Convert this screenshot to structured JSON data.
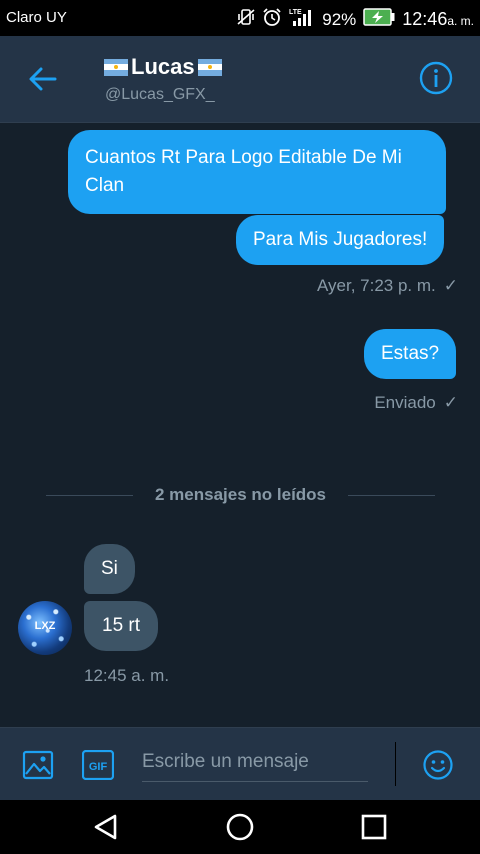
{
  "status": {
    "carrier": "Claro UY",
    "battery": "92%",
    "time": "12:46",
    "ampm": "a. m."
  },
  "header": {
    "name": "Lucas",
    "handle": "@Lucas_GFX_"
  },
  "messages": {
    "out1": "Cuantos Rt Para Logo Editable De Mi Clan",
    "out2": "Para Mis Jugadores!",
    "meta1": "Ayer, 7:23 p. m.",
    "out3": "Estas?",
    "meta2": "Enviado",
    "check": "✓",
    "unread": "2 mensajes no leídos",
    "in1": "Si",
    "in2": "15 rt",
    "meta3": "12:45 a. m.",
    "avatar_text": "LXZ"
  },
  "composer": {
    "placeholder": "Escribe un mensaje",
    "gif": "GIF"
  },
  "colors": {
    "accent": "#1da1f2",
    "bg": "#15202b",
    "bar": "#243447"
  }
}
